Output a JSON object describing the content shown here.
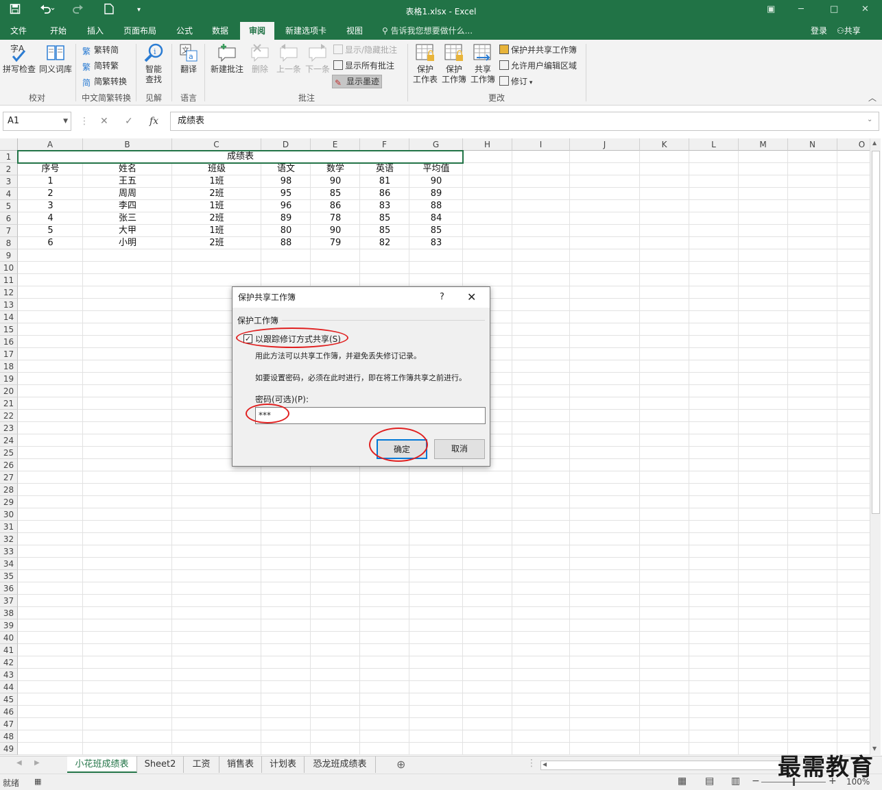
{
  "titlebar": {
    "title": "表格1.xlsx - Excel",
    "save_icon": "save-icon",
    "undo_icon": "undo-icon",
    "redo_icon": "redo-icon",
    "newdoc_icon": "new-document-icon",
    "customize_icon": "customize-quick-access-icon"
  },
  "tabs": [
    "文件",
    "开始",
    "插入",
    "页面布局",
    "公式",
    "数据",
    "审阅",
    "新建选项卡",
    "视图"
  ],
  "active_tab": "审阅",
  "tell_me": "告诉我您想要做什么...",
  "login": "登录",
  "share": "共享",
  "ribbon": {
    "spell_check": "拼写检查",
    "thesaurus": "同义词库",
    "group_proofing": "校对",
    "to_simplified": "繁转简",
    "to_traditional": "简转繁",
    "convert": "简繁转换",
    "group_chinese": "中文简繁转换",
    "smart_lookup_1": "智能",
    "smart_lookup_2": "查找",
    "group_insights": "见解",
    "translate": "翻译",
    "group_language": "语言",
    "new_comment": "新建批注",
    "delete": "删除",
    "previous": "上一条",
    "next": "下一条",
    "show_hide_comment": "显示/隐藏批注",
    "show_all_comments": "显示所有批注",
    "show_ink": "显示墨迹",
    "group_comments": "批注",
    "protect_sheet_1": "保护",
    "protect_sheet_2": "工作表",
    "protect_workbook_1": "保护",
    "protect_workbook_2": "工作簿",
    "share_workbook_1": "共享",
    "share_workbook_2": "工作簿",
    "protect_share": "保护并共享工作簿",
    "allow_edit": "允许用户编辑区域",
    "track_changes": "修订",
    "group_changes": "更改"
  },
  "formula_bar": {
    "name_box": "A1",
    "fx": "fx",
    "value": "成绩表"
  },
  "columns": [
    "A",
    "B",
    "C",
    "D",
    "E",
    "F",
    "G",
    "H",
    "I",
    "J",
    "K",
    "L",
    "M",
    "N",
    "O"
  ],
  "rows": [
    "1",
    "2",
    "3",
    "4",
    "5",
    "6",
    "7",
    "8",
    "9",
    "10",
    "11",
    "12",
    "13",
    "14",
    "15",
    "16",
    "17",
    "18",
    "19",
    "20",
    "21",
    "22",
    "23",
    "24",
    "25",
    "26",
    "27",
    "28",
    "29",
    "30",
    "31",
    "32",
    "33",
    "34",
    "35",
    "36",
    "37",
    "38",
    "39",
    "40",
    "41",
    "42",
    "43",
    "44",
    "45",
    "46",
    "47",
    "48",
    "49"
  ],
  "sheet": {
    "title": "成绩表",
    "headers": [
      "序号",
      "姓名",
      "班级",
      "语文",
      "数学",
      "英语",
      "平均值"
    ],
    "data": [
      [
        "1",
        "王五",
        "1班",
        "98",
        "90",
        "81",
        "90"
      ],
      [
        "2",
        "周周",
        "2班",
        "95",
        "85",
        "86",
        "89"
      ],
      [
        "3",
        "李四",
        "1班",
        "96",
        "86",
        "83",
        "88"
      ],
      [
        "4",
        "张三",
        "2班",
        "89",
        "78",
        "85",
        "84"
      ],
      [
        "5",
        "大甲",
        "1班",
        "80",
        "90",
        "85",
        "85"
      ],
      [
        "6",
        "小明",
        "2班",
        "88",
        "79",
        "82",
        "83"
      ]
    ]
  },
  "sheet_tabs": [
    "小花班成绩表",
    "Sheet2",
    "工资",
    "销售表",
    "计划表",
    "恐龙班成绩表"
  ],
  "active_sheet": "小花班成绩表",
  "status": {
    "ready": "就绪",
    "zoom": "100%",
    "zoom_level": 1.0
  },
  "watermark": "最需教育",
  "dialog": {
    "title": "保护共享工作簿",
    "help": "?",
    "group": "保护工作簿",
    "checkbox_label": "以跟踪修订方式共享(S)",
    "checkbox_checked": true,
    "desc1": "用此方法可以共享工作簿，并避免丢失修订记录。",
    "desc2": "如要设置密码，必须在此时进行，即在将工作簿共享之前进行。",
    "password_label": "密码(可选)(P):",
    "password_value": "***",
    "ok": "确定",
    "cancel": "取消"
  },
  "colors": {
    "excel_green": "#217346",
    "annotation_red": "#e02020"
  }
}
